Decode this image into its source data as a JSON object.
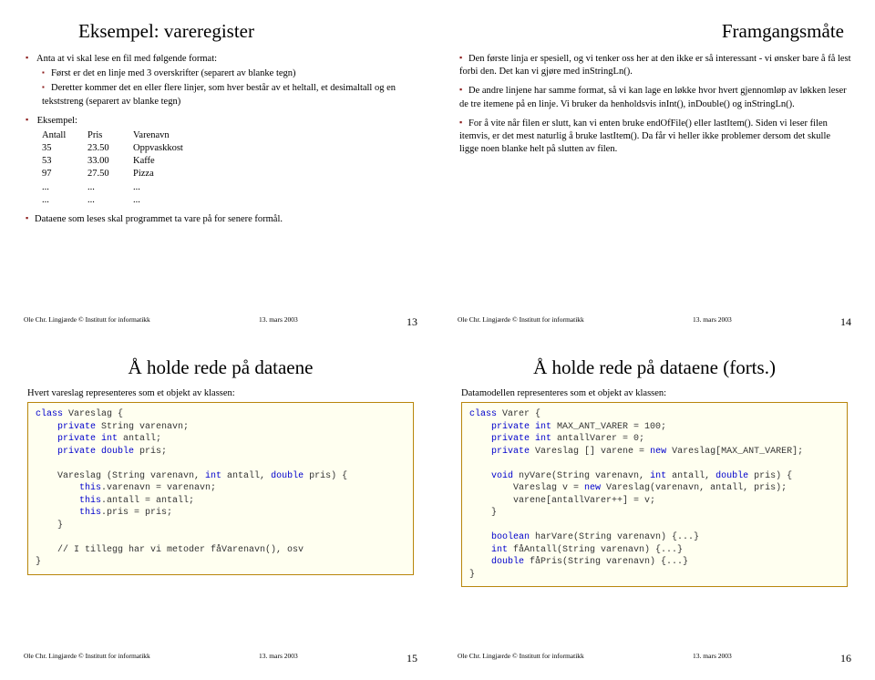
{
  "slide13": {
    "title": "Eksempel: vareregister",
    "b1": "Anta at vi skal lese en fil med følgende format:",
    "b1a": "Først er det en linje med 3 overskrifter (separert av blanke tegn)",
    "b1b": "Deretter kommer det en eller flere linjer, som hver består av et heltall, et desimaltall og en tekststreng (separert av blanke tegn)",
    "b2": "Eksempel:",
    "tbl": {
      "h0": "Antall",
      "h1": "Pris",
      "h2": "Varenavn",
      "r0c0": "35",
      "r0c1": "23.50",
      "r0c2": "Oppvaskkost",
      "r1c0": "53",
      "r1c1": "33.00",
      "r1c2": "Kaffe",
      "r2c0": "97",
      "r2c1": "27.50",
      "r2c2": "Pizza",
      "r3c0": "...",
      "r3c1": "...",
      "r3c2": "...",
      "r4c0": "...",
      "r4c1": "...",
      "r4c2": "..."
    },
    "b3": "Dataene som leses skal programmet ta vare på for senere formål.",
    "pagenum": "13"
  },
  "slide14": {
    "title": "Framgangsmåte",
    "b1": "Den første linja er spesiell, og vi tenker oss her at den ikke er så interessant - vi ønsker bare å få lest forbi den.  Det kan vi gjøre med inStringLn().",
    "b2": "De andre linjene har samme format, så vi kan lage en løkke hvor hvert gjennomløp av løkken leser de tre itemene på en linje.  Vi bruker da henholdsvis inInt(), inDouble() og inStringLn().",
    "b3": "For å vite når filen er slutt, kan vi enten bruke endOfFile() eller lastItem().  Siden vi leser filen itemvis, er det mest naturlig å bruke lastItem().  Da får vi heller ikke problemer dersom det skulle ligge noen blanke helt på slutten av filen.",
    "pagenum": "14"
  },
  "slide15": {
    "title": "Å holde rede på dataene",
    "intro": "Hvert vareslag representeres som et objekt av klassen:",
    "pagenum": "15"
  },
  "slide16": {
    "title": "Å holde rede på dataene (forts.)",
    "intro": "Datamodellen representeres som et objekt av klassen:",
    "pagenum": "16"
  },
  "footer": {
    "author": "Ole Chr. Lingjærde © Institutt for informatikk",
    "date": "13. mars 2003"
  }
}
